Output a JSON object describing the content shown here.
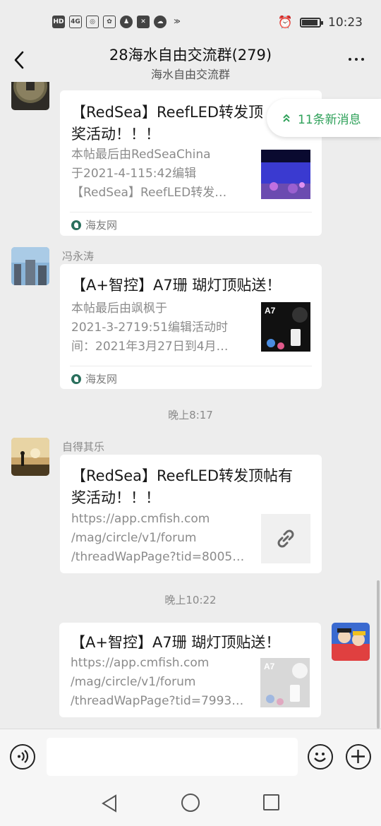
{
  "status_bar": {
    "left_icons": [
      "hd-icon",
      "4g-signal-icon",
      "hotspot-icon",
      "app-icon",
      "qq-icon",
      "capcut-icon",
      "cloud-icon",
      "wings-icon"
    ],
    "hd_text": "HD",
    "network_text": "4G",
    "time": "10:23"
  },
  "header": {
    "title": "28海水自由交流群(279)",
    "subtitle": "海水自由交流群"
  },
  "new_messages": {
    "label": "11条新消息"
  },
  "messages": [
    {
      "sender": "",
      "title": "【RedSea】ReefLED转发顶帖有奖活动！！！",
      "title_line1": "【RedSea】ReefLED转发顶",
      "title_line2": "奖活动！！！",
      "desc_line1": "本帖最后由RedSeaChina",
      "desc_line2": "于2021-4-115:42编辑",
      "desc_line3": "【RedSea】ReefLED转发…",
      "source": "海友网"
    },
    {
      "sender": "冯永涛",
      "title_line1": "【A+智控】A7珊 瑚灯顶贴送！",
      "desc_line1": "本帖最后由飒枫于",
      "desc_line2": "2021-3-2719:51编辑活动时",
      "desc_line3": "间：2021年3月27日到4月…",
      "thumb_label": "A7",
      "source": "海友网"
    },
    {
      "timestamp": "晚上8:17"
    },
    {
      "sender": "自得其乐",
      "title_line1": "【RedSea】ReefLED转发顶帖有",
      "title_line2": "奖活动！！！",
      "desc_line1": "https://app.cmfish.com",
      "desc_line2": "/mag/circle/v1/forum",
      "desc_line3": "/threadWapPage?tid=8005…"
    },
    {
      "timestamp": "晚上10:22"
    },
    {
      "sender": "self",
      "title_line1": "【A+智控】A7珊 瑚灯顶贴送！",
      "desc_line1": "https://app.cmfish.com",
      "desc_line2": "/mag/circle/v1/forum",
      "desc_line3": "/threadWapPage?tid=7993…",
      "thumb_label": "A7"
    }
  ],
  "colors": {
    "background": "#ededed",
    "card": "#ffffff",
    "accent_green": "#2fa15a",
    "muted_text": "#8b8b8b"
  }
}
